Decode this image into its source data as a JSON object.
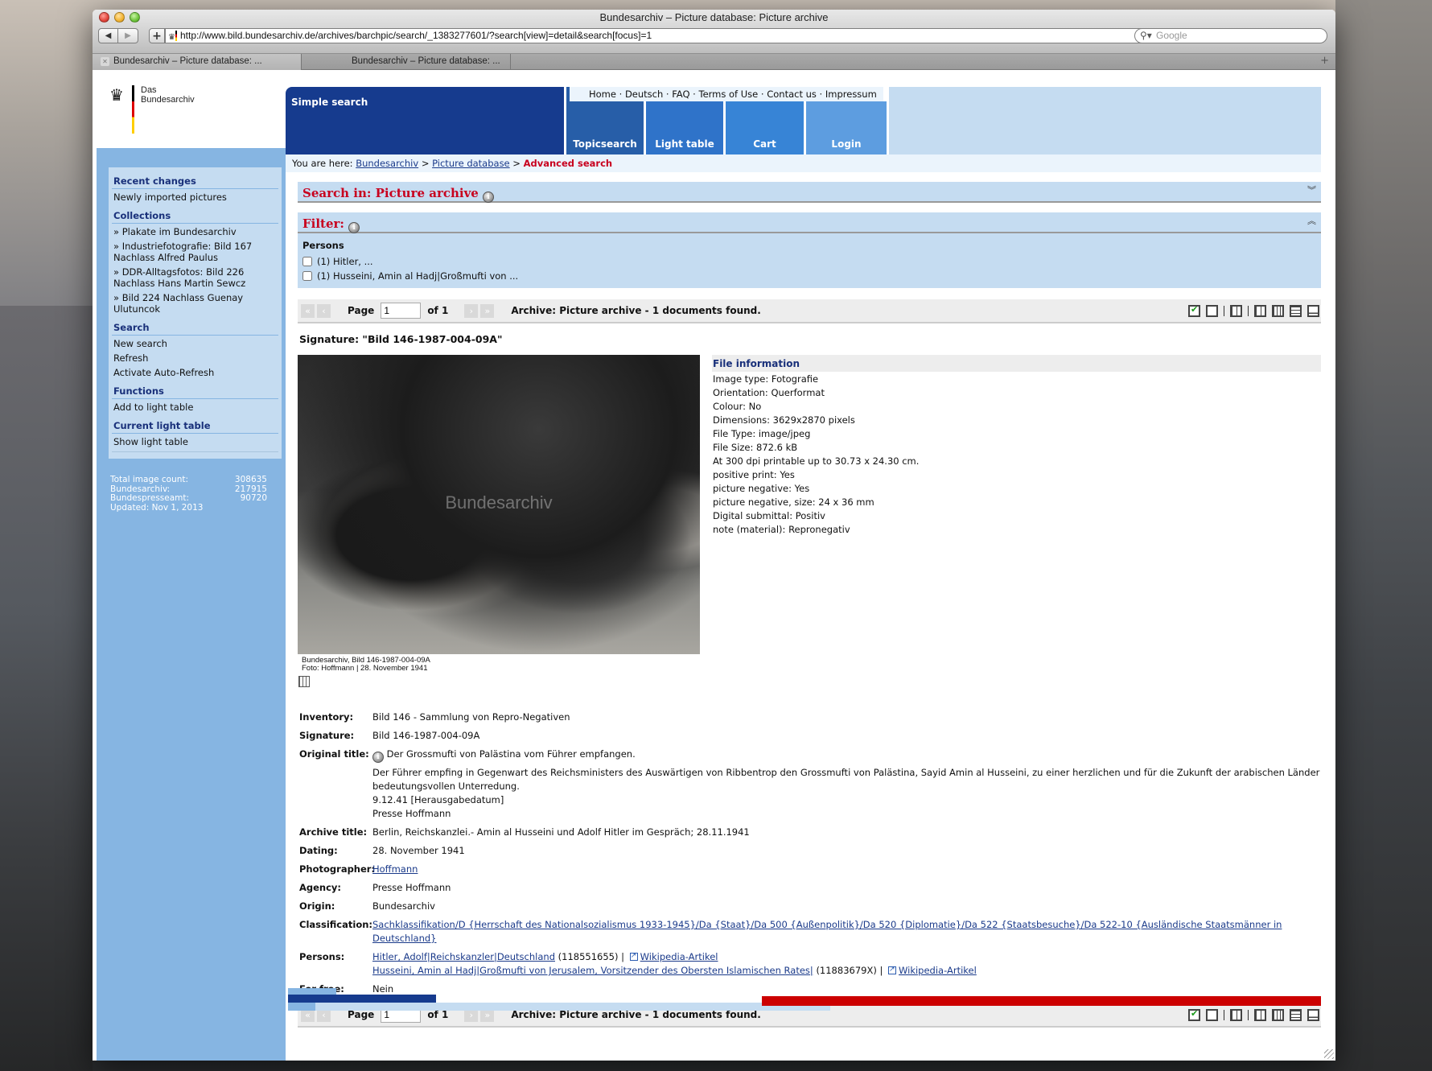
{
  "browser": {
    "window_title": "Bundesarchiv – Picture database: Picture archive",
    "url": "http://www.bild.bundesarchiv.de/archives/barchpic/search/_1383277601/?search[view]=detail&search[focus]=1",
    "search_placeholder": "Google",
    "back_icon": "◀",
    "forward_icon": "▶",
    "add_icon": "+",
    "reload_icon": "↻",
    "tabs": [
      {
        "label": "Bundesarchiv – Picture database: ...",
        "active": true
      },
      {
        "label": "Bundesarchiv – Picture database: ...",
        "active": false
      }
    ]
  },
  "logo": {
    "line1": "Das",
    "line2": "Bundesarchiv"
  },
  "header": {
    "simple_search": "Simple search",
    "links": "Home · Deutsch · FAQ · Terms of Use · Contact us · Impressum",
    "link_items": [
      "Home",
      "Deutsch",
      "FAQ",
      "Terms of Use",
      "Contact us",
      "Impressum"
    ],
    "tabs": [
      "Topicsearch",
      "Light table",
      "Cart",
      "Login"
    ]
  },
  "breadcrumb": {
    "prefix": "You are here:",
    "items": [
      "Bundesarchiv",
      "Picture database"
    ],
    "separator": ">",
    "current": "Advanced search"
  },
  "sidebar": {
    "sections": [
      {
        "heading": "Recent changes",
        "items": [
          "Newly imported pictures"
        ]
      },
      {
        "heading": "Collections",
        "items": [
          "» Plakate im Bundesarchiv",
          "» Industriefotografie: Bild 167 Nachlass Alfred Paulus",
          "» DDR-Alltagsfotos: Bild 226 Nachlass Hans Martin Sewcz",
          "» Bild 224 Nachlass Guenay Ulutuncok"
        ]
      },
      {
        "heading": "Search",
        "items": [
          "New search",
          "Refresh",
          "Activate Auto-Refresh"
        ]
      },
      {
        "heading": "Functions",
        "items": [
          "Add to light table"
        ]
      },
      {
        "heading": "Current light table",
        "items": [
          "Show light table"
        ]
      }
    ],
    "stats": [
      {
        "label": "Total image count:",
        "value": "308635"
      },
      {
        "label": "Bundesarchiv:",
        "value": "217915"
      },
      {
        "label": "Bundespresseamt:",
        "value": "90720"
      },
      {
        "label": "Updated:  Nov 1, 2013",
        "value": ""
      }
    ]
  },
  "search_in": {
    "title": "Search in: Picture archive",
    "toggle": "expand"
  },
  "filter": {
    "title": "Filter:",
    "group": "Persons",
    "options": [
      {
        "label": "(1) Hitler, ...",
        "checked": false
      },
      {
        "label": "(1) Husseini, Amin al Hadj|Großmufti von ...",
        "checked": false
      }
    ]
  },
  "pager": {
    "page_label": "Page",
    "page_value": "1",
    "of_label": "of 1",
    "status": "Archive: Picture archive - 1 documents found.",
    "first_icon": "«",
    "prev_icon": "‹",
    "next_icon": "›",
    "last_icon": "»"
  },
  "record": {
    "signature_heading": "Signature: \"Bild 146-1987-004-09A\"",
    "photo_watermark": "Bundesarchiv",
    "photo_caption_1": "Bundesarchiv, Bild 146-1987-004-09A",
    "photo_caption_2": "Foto: Hoffmann | 28. November 1941",
    "file_info": {
      "heading": "File information",
      "rows": [
        "Image type: Fotografie",
        "Orientation: Querformat",
        "Colour: No",
        "Dimensions: 3629x2870 pixels",
        "File Type: image/jpeg",
        "File Size: 872.6 kB",
        "At 300 dpi printable up to 30.73 x 24.30 cm.",
        "positive print: Yes",
        "picture negative: Yes",
        "picture negative, size: 24 x 36 mm",
        "Digital submittal: Positiv",
        "note (material): Repronegativ"
      ]
    },
    "fields": {
      "inventory": {
        "label": "Inventory:",
        "value": "Bild 146 - Sammlung von Repro-Negativen"
      },
      "signature": {
        "label": "Signature:",
        "value": "Bild 146-1987-004-09A"
      },
      "original_title": {
        "label": "Original title:",
        "headline": "Der Grossmufti von Palästina vom Führer empfangen.",
        "body": "Der Führer empfing in Gegenwart des Reichsministers des Auswärtigen von Ribbentrop den Grossmufti von Palästina, Sayid Amin al Husseini, zu einer herzlichen und für die Zukunft der arabischen Länder bedeutungsvollen Unterredung.",
        "date": "9.12.41 [Herausgabedatum]",
        "source": "Presse Hoffmann"
      },
      "archive_title": {
        "label": "Archive title:",
        "value": "Berlin, Reichskanzlei.- Amin al Husseini und Adolf Hitler im Gespräch; 28.11.1941"
      },
      "dating": {
        "label": "Dating:",
        "value": "28. November 1941"
      },
      "photographer": {
        "label": "Photographer:",
        "value": "Hoffmann"
      },
      "agency": {
        "label": "Agency:",
        "value": "Presse Hoffmann"
      },
      "origin": {
        "label": "Origin:",
        "value": "Bundesarchiv"
      },
      "classification": {
        "label": "Classification:",
        "value": "Sachklassifikation/D {Herrschaft des Nationalsozialismus 1933-1945}/Da {Staat}/Da 500 {Außenpolitik}/Da 520 {Diplomatie}/Da 522 {Staatsbesuche}/Da 522-10 {Ausländische Staatsmänner in Deutschland}"
      },
      "persons": {
        "label": "Persons:",
        "entries": [
          {
            "name": "Hitler, Adolf|Reichskanzler|Deutschland",
            "id": "(118551655) |",
            "link": "Wikipedia-Artikel"
          },
          {
            "name": "Husseini, Amin al Hadj|Großmufti von Jerusalem, Vorsitzender des Obersten Islamischen Rates|",
            "id": "(11883679X) |",
            "link": "Wikipedia-Artikel"
          }
        ]
      },
      "for_free": {
        "label": "For free:",
        "value": "Nein"
      }
    }
  }
}
